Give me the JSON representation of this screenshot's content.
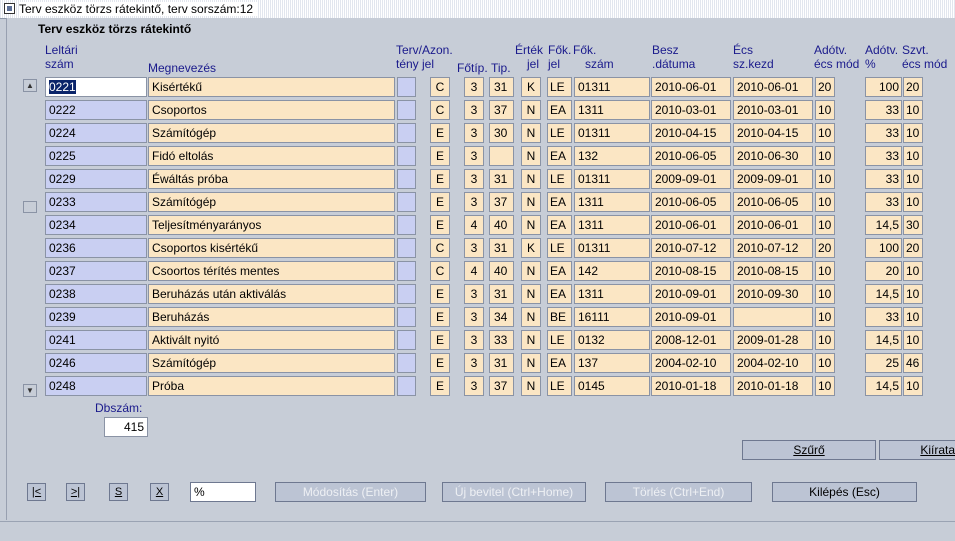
{
  "window": {
    "title": "Terv eszköz törzs rátekintő, terv sorszám:12"
  },
  "form": {
    "title": "Terv eszköz törzs rátekintő"
  },
  "headers": {
    "leltari_1": "Leltári",
    "leltari_2": "szám",
    "megnevezes": "Megnevezés",
    "terv_1": "Terv/Azon.",
    "terv_2": "tény jel",
    "fotip": "Főtíp.",
    "tip": "Tip.",
    "ertek_1": "Érték",
    "ertek_2": "jel",
    "fok_1": "Fők.",
    "fok_2": "jel",
    "fokszam_1": "Fők.",
    "fokszam_2": "szám",
    "besz_1": "Besz",
    "besz_2": ".dátuma",
    "ecs_1": "Écs",
    "ecs_2": "sz.kezd",
    "adotv_1": "Adótv.",
    "adotv_2": "écs mód",
    "adotvpct_1": "Adótv.",
    "adotvpct_2": "%",
    "szvt_1": "Szvt.",
    "szvt_2": "écs mód"
  },
  "rows": [
    {
      "code": "0221",
      "name": "Kisértékű",
      "azon": "C",
      "fotip": "3",
      "tip": "31",
      "ertek": "K",
      "fok": "LE",
      "szam": "01311",
      "besz": "2010-06-01",
      "ecs": "2010-06-01",
      "adoecs": "20",
      "adopct": "100",
      "szvt": "20"
    },
    {
      "code": "0222",
      "name": "Csoportos",
      "azon": "C",
      "fotip": "3",
      "tip": "37",
      "ertek": "N",
      "fok": "EA",
      "szam": "1311",
      "besz": "2010-03-01",
      "ecs": "2010-03-01",
      "adoecs": "10",
      "adopct": "33",
      "szvt": "10"
    },
    {
      "code": "0224",
      "name": "Számítógép",
      "azon": "E",
      "fotip": "3",
      "tip": "30",
      "ertek": "N",
      "fok": "LE",
      "szam": "01311",
      "besz": "2010-04-15",
      "ecs": "2010-04-15",
      "adoecs": "10",
      "adopct": "33",
      "szvt": "10"
    },
    {
      "code": "0225",
      "name": "Fidó eltolás",
      "azon": "E",
      "fotip": "3",
      "tip": "",
      "ertek": "N",
      "fok": "EA",
      "szam": "132",
      "besz": "2010-06-05",
      "ecs": "2010-06-30",
      "adoecs": "10",
      "adopct": "33",
      "szvt": "10"
    },
    {
      "code": "0229",
      "name": "Éwáltás próba",
      "azon": "E",
      "fotip": "3",
      "tip": "31",
      "ertek": "N",
      "fok": "LE",
      "szam": "01311",
      "besz": "2009-09-01",
      "ecs": "2009-09-01",
      "adoecs": "10",
      "adopct": "33",
      "szvt": "10"
    },
    {
      "code": "0233",
      "name": "Számítógép",
      "azon": "E",
      "fotip": "3",
      "tip": "37",
      "ertek": "N",
      "fok": "EA",
      "szam": "1311",
      "besz": "2010-06-05",
      "ecs": "2010-06-05",
      "adoecs": "10",
      "adopct": "33",
      "szvt": "10"
    },
    {
      "code": "0234",
      "name": "Teljesítményarányos",
      "azon": "E",
      "fotip": "4",
      "tip": "40",
      "ertek": "N",
      "fok": "EA",
      "szam": "1311",
      "besz": "2010-06-01",
      "ecs": "2010-06-01",
      "adoecs": "10",
      "adopct": "14,5",
      "szvt": "30"
    },
    {
      "code": "0236",
      "name": "Csoportos kisértékű",
      "azon": "C",
      "fotip": "3",
      "tip": "31",
      "ertek": "K",
      "fok": "LE",
      "szam": "01311",
      "besz": "2010-07-12",
      "ecs": "2010-07-12",
      "adoecs": "20",
      "adopct": "100",
      "szvt": "20"
    },
    {
      "code": "0237",
      "name": "Csoortos térítés mentes",
      "azon": "C",
      "fotip": "4",
      "tip": "40",
      "ertek": "N",
      "fok": "EA",
      "szam": "142",
      "besz": "2010-08-15",
      "ecs": "2010-08-15",
      "adoecs": "10",
      "adopct": "20",
      "szvt": "10"
    },
    {
      "code": "0238",
      "name": "Beruházás után aktiválás",
      "azon": "E",
      "fotip": "3",
      "tip": "31",
      "ertek": "N",
      "fok": "EA",
      "szam": "1311",
      "besz": "2010-09-01",
      "ecs": "2010-09-30",
      "adoecs": "10",
      "adopct": "14,5",
      "szvt": "10"
    },
    {
      "code": "0239",
      "name": "Beruházás",
      "azon": "E",
      "fotip": "3",
      "tip": "34",
      "ertek": "N",
      "fok": "BE",
      "szam": "16111",
      "besz": "2010-09-01",
      "ecs": "",
      "adoecs": "10",
      "adopct": "33",
      "szvt": "10"
    },
    {
      "code": "0241",
      "name": "Aktivált nyitó",
      "azon": "E",
      "fotip": "3",
      "tip": "33",
      "ertek": "N",
      "fok": "LE",
      "szam": "0132",
      "besz": "2008-12-01",
      "ecs": "2009-01-28",
      "adoecs": "10",
      "adopct": "14,5",
      "szvt": "10"
    },
    {
      "code": "0246",
      "name": "Számítógép",
      "azon": "E",
      "fotip": "3",
      "tip": "31",
      "ertek": "N",
      "fok": "EA",
      "szam": "137",
      "besz": "2004-02-10",
      "ecs": "2004-02-10",
      "adoecs": "10",
      "adopct": "25",
      "szvt": "46"
    },
    {
      "code": "0248",
      "name": "Próba",
      "azon": "E",
      "fotip": "3",
      "tip": "37",
      "ertek": "N",
      "fok": "LE",
      "szam": "0145",
      "besz": "2010-01-18",
      "ecs": "2010-01-18",
      "adoecs": "10",
      "adopct": "14,5",
      "szvt": "10"
    }
  ],
  "dbszam": {
    "label": "Dbszám:",
    "value": "415"
  },
  "buttons": {
    "szuro": "Szűrő",
    "kiiratas": "Kiírata",
    "first": "|<",
    "last": ">|",
    "s": "S",
    "x": "X",
    "search_value": "%",
    "modositas": "Módosítás (Enter)",
    "uj_bevitel": "Új bevitel (Ctrl+Home)",
    "torles": "Törlés (Ctrl+End)",
    "kilepes": "Kilépés (Esc)"
  },
  "icons": {
    "window": "form-icon",
    "scroll_up": "scroll-up-icon",
    "scroll_down": "scroll-down-icon"
  }
}
